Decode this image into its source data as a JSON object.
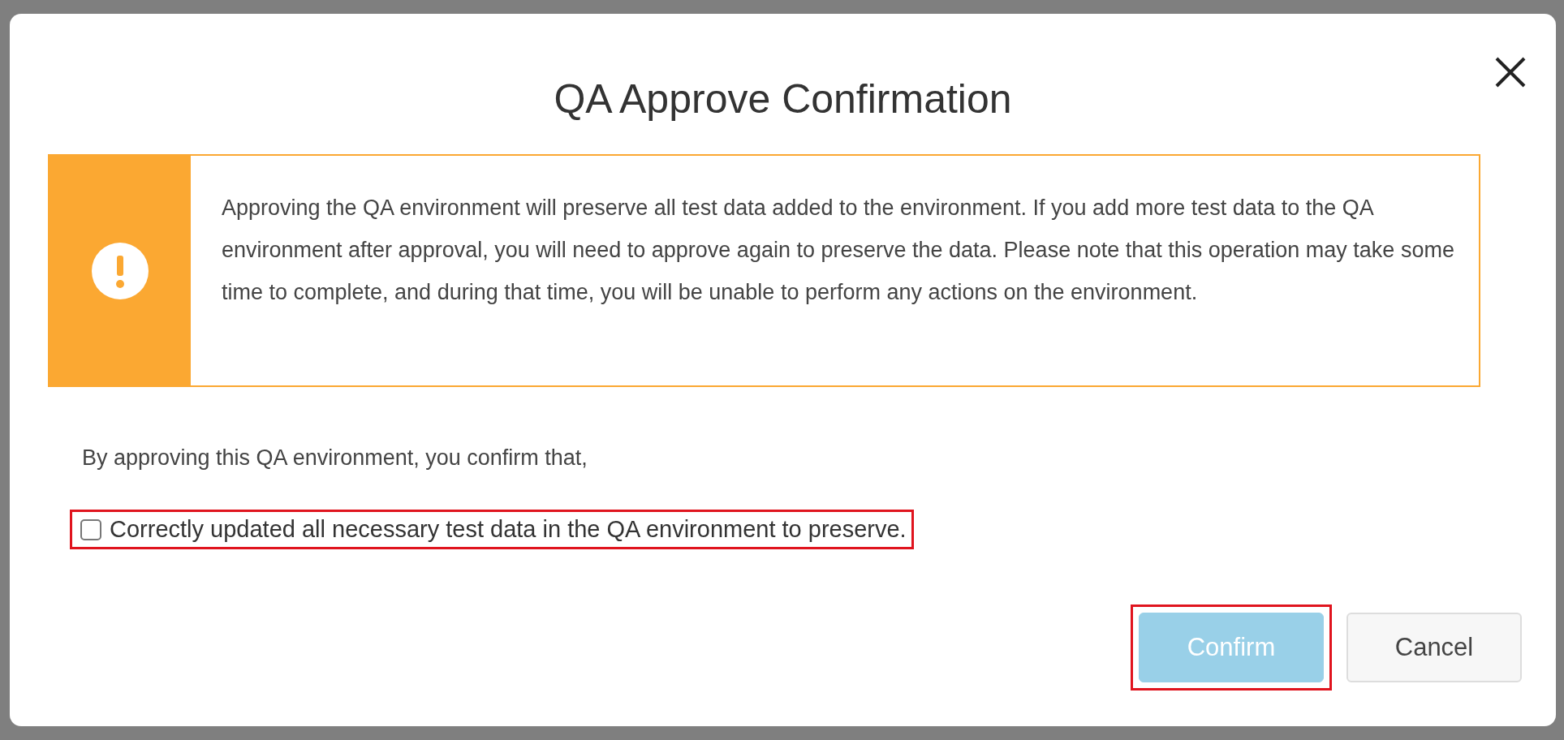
{
  "dialog": {
    "title": "QA Approve Confirmation",
    "alert": {
      "kind": "warning",
      "message": "Approving the QA environment will preserve all test data added to the environment. If you add more test data to the QA environment after approval, you will need to approve again to preserve the data. Please note that this operation may take some time to complete, and during that time, you will be unable to perform any actions on the environment."
    },
    "intro": "By approving this QA environment, you confirm that,",
    "checkbox": {
      "label": "Correctly updated all necessary test data in the QA environment to preserve.",
      "checked": false,
      "highlighted": true
    },
    "buttons": [
      {
        "label": "Confirm",
        "kind": "primary",
        "disabled": true,
        "highlighted": true
      },
      {
        "label": "Cancel",
        "kind": "secondary",
        "disabled": false,
        "highlighted": false
      }
    ]
  }
}
